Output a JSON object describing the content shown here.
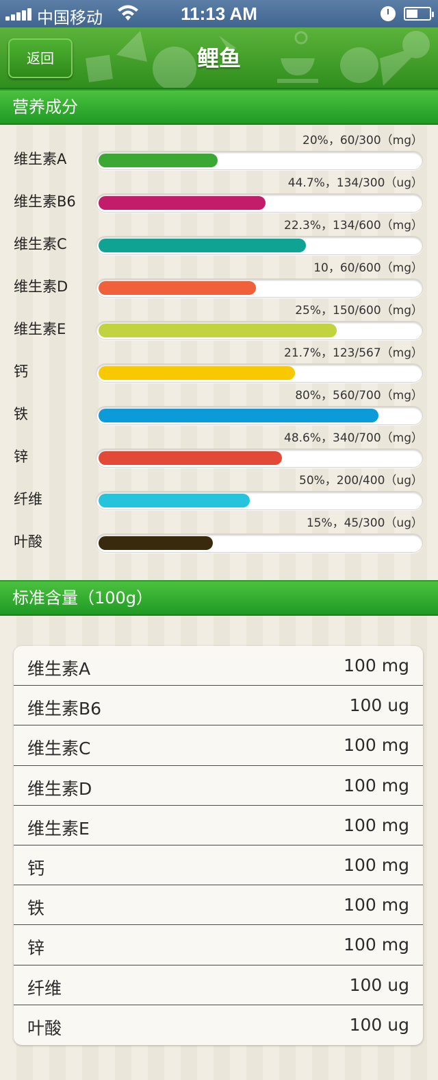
{
  "status_bar": {
    "carrier": "中国移动",
    "time": "11:13 AM"
  },
  "nav": {
    "back_label": "返回",
    "title": "鲤鱼"
  },
  "nutrition_section": {
    "title": "营养成分",
    "items": [
      {
        "name": "维生素A",
        "value_text": "20%，60/300（mg）",
        "percent": 0.37,
        "color": "#3aa832"
      },
      {
        "name": "维生素B6",
        "value_text": "44.7%，134/300（ug）",
        "percent": 0.52,
        "color": "#c21c6a"
      },
      {
        "name": "维生素C",
        "value_text": "22.3%，134/600（mg）",
        "percent": 0.645,
        "color": "#0fa393"
      },
      {
        "name": "维生素D",
        "value_text": "10，60/600（mg）",
        "percent": 0.49,
        "color": "#f0603a"
      },
      {
        "name": "维生素E",
        "value_text": "25%，150/600（mg）",
        "percent": 0.74,
        "color": "#c1d33e"
      },
      {
        "name": "钙",
        "value_text": "21.7%，123/567（mg）",
        "percent": 0.61,
        "color": "#f8c900"
      },
      {
        "name": "铁",
        "value_text": "80%，560/700（mg）",
        "percent": 0.87,
        "color": "#0b9bd8"
      },
      {
        "name": "锌",
        "value_text": "48.6%，340/700（mg）",
        "percent": 0.57,
        "color": "#e24a37"
      },
      {
        "name": "纤维",
        "value_text": "50%，200/400（ug）",
        "percent": 0.47,
        "color": "#25c4dc"
      },
      {
        "name": "叶酸",
        "value_text": "15%，45/300（ug）",
        "percent": 0.355,
        "color": "#3a2a0d"
      }
    ]
  },
  "standard_section": {
    "title": "标准含量（100g）",
    "rows": [
      {
        "name": "维生素A",
        "amount": "100 mg"
      },
      {
        "name": "维生素B6",
        "amount": "100 ug"
      },
      {
        "name": "维生素C",
        "amount": "100 mg"
      },
      {
        "name": "维生素D",
        "amount": "100 mg"
      },
      {
        "name": "维生素E",
        "amount": "100 mg"
      },
      {
        "name": "钙",
        "amount": "100 mg"
      },
      {
        "name": "铁",
        "amount": "100 mg"
      },
      {
        "name": "锌",
        "amount": "100 mg"
      },
      {
        "name": "纤维",
        "amount": "100 ug"
      },
      {
        "name": "叶酸",
        "amount": "100 ug"
      }
    ]
  }
}
